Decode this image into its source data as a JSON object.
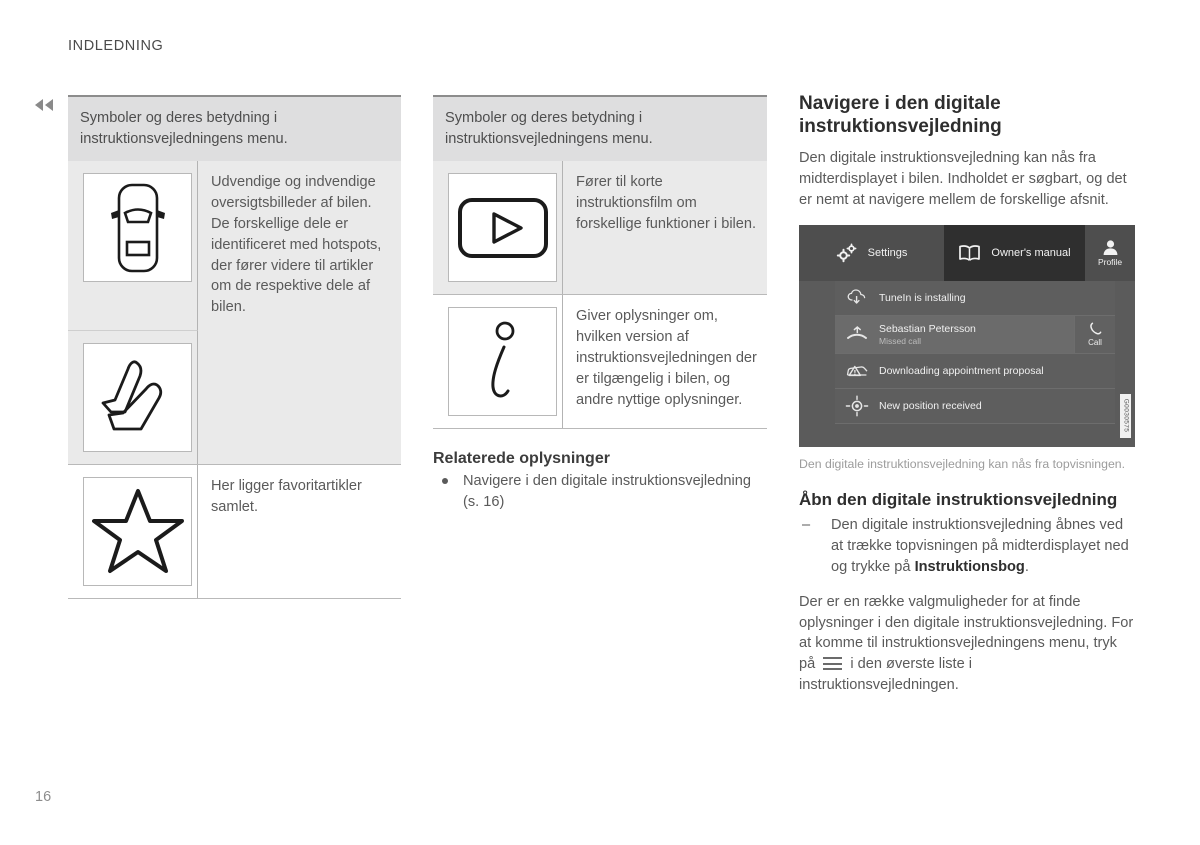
{
  "page": {
    "chapter": "INDLEDNING",
    "number": "16",
    "prev_nav_icon": "double-chevron-left-icon"
  },
  "left_table": {
    "header": "Symboler og deres betydning i instruktionsvejledningens menu.",
    "rows": [
      {
        "icons": [
          "car-top-view-icon",
          "car-seat-icon"
        ],
        "text": "Udvendige og indvendige oversigtsbilleder af bilen. De forskellige dele er identificeret med hotspots, der fører videre til artikler om de respektive dele af bilen."
      },
      {
        "icons": [
          "star-icon"
        ],
        "text": "Her ligger favoritartikler samlet."
      }
    ]
  },
  "mid_table": {
    "header": "Symboler og deres betydning i instruktionsvejledningens menu.",
    "rows": [
      {
        "icons": [
          "video-play-icon"
        ],
        "text": "Fører til korte instruktionsfilm om forskellige funktioner i bilen."
      },
      {
        "icons": [
          "info-i-icon"
        ],
        "text": "Giver oplysninger om, hvilken version af instruktionsvejledningen der er tilgængelig i bilen, og andre nyttige oplysninger."
      }
    ]
  },
  "related": {
    "title": "Relaterede oplysninger",
    "items": [
      "Navigere i den digitale instruktionsvejledning (s. 16)"
    ]
  },
  "right": {
    "heading": "Navigere i den digitale instruktionsvejledning",
    "intro": "Den digitale instruktionsvejledning kan nås fra midterdisplayet i bilen. Indholdet er søgbart, og det er nemt at navigere mellem de forskellige afsnit.",
    "figure_caption": "Den digitale instruktionsvejledning kan nås fra topvisningen.",
    "figure_id": "G0030575",
    "subheading": "Åbn den digitale instruktionsvejledning",
    "bullet_prefix": "Den digitale instruktionsvejledning åbnes ved at trække topvisningen på midterdisplayet ned og trykke på ",
    "bullet_bold": "Instruktionsbog",
    "bullet_suffix": ".",
    "dash_marker": "–",
    "closing_part1": "Der er en række valgmuligheder for at finde oplysninger i den digitale instruktionsvejledning. For at komme til instruktionsvejledningens menu, tryk på",
    "closing_part2": "i den øverste liste i instruktionsvejledningen."
  },
  "infotainment": {
    "topbar": [
      {
        "label": "Settings",
        "icon": "gears-icon"
      },
      {
        "label": "Owner's manual",
        "icon": "open-book-icon"
      },
      {
        "label": "Profile",
        "icon": "person-icon"
      }
    ],
    "notifications": [
      {
        "title": "TuneIn is installing",
        "sub": "",
        "icon": "cloud-download-icon",
        "action": ""
      },
      {
        "title": "Sebastian Petersson",
        "sub": "Missed call",
        "icon": "missed-call-icon",
        "action": "Call",
        "action_icon": "phone-icon"
      },
      {
        "title": "Downloading appointment proposal",
        "sub": "",
        "icon": "car-warning-icon",
        "action": ""
      },
      {
        "title": "New position received",
        "sub": "",
        "icon": "crosshair-icon",
        "action": ""
      }
    ]
  },
  "colors": {
    "table_header_bg": "#dededf",
    "table_row_shaded": "#eaeaea",
    "body_text": "#5a5a5a",
    "heading_text": "#2e2e2e",
    "screen_bg": "#5b5b5b",
    "screen_topbar": "#4e4e4e",
    "screen_active_tab": "#2f2f2f"
  }
}
